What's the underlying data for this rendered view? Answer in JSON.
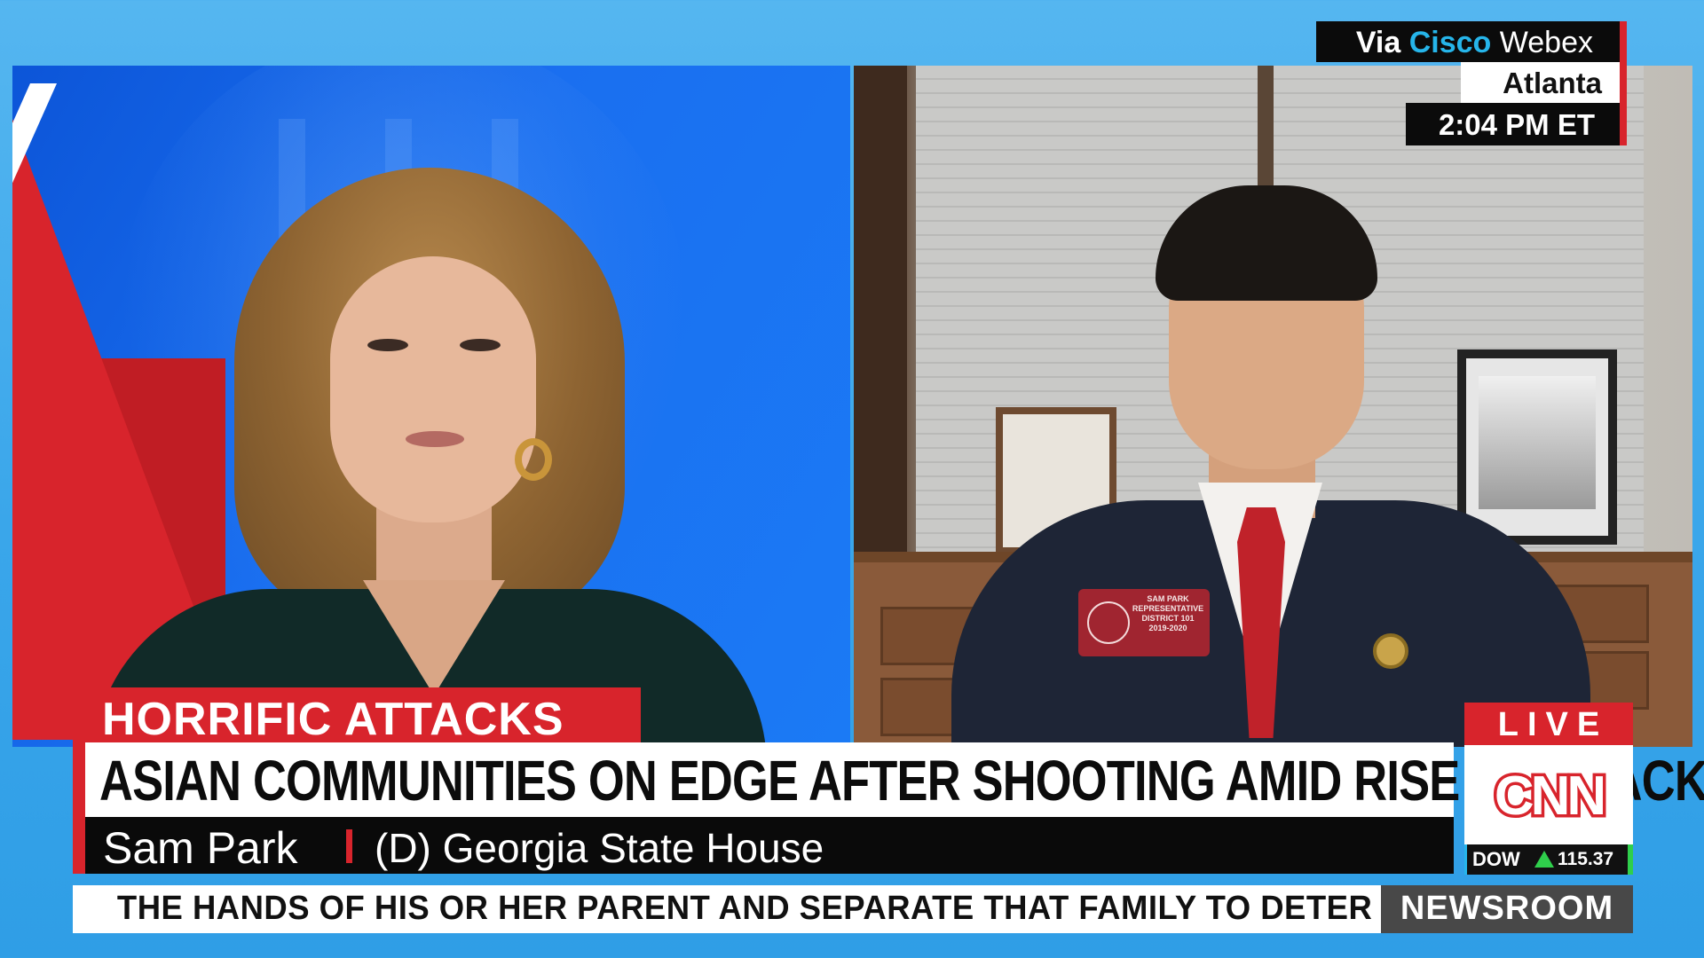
{
  "source_box": {
    "via": "Via",
    "cisco": "Cisco",
    "webex": "Webex"
  },
  "location": "Atlanta",
  "time": "2:04 PM ET",
  "lower_third": {
    "topic": "HORRIFIC ATTACKS",
    "headline": "ASIAN COMMUNITIES ON EDGE AFTER SHOOTING AMID RISE IN ATTACKS",
    "name": "Sam Park",
    "title": "(D) Georgia State House"
  },
  "badge": {
    "name": "SAM PARK",
    "line1": "REPRESENTATIVE",
    "line2": "DISTRICT 101",
    "line3": "2019-2020"
  },
  "live_label": "LIVE",
  "network_logo": "CNN",
  "market": {
    "label": "DOW",
    "direction": "up",
    "value": "115.37"
  },
  "ticker_text": "THE HANDS OF HIS OR HER PARENT AND SEPARATE THAT FAMILY TO DETER",
  "show_name": "NEWSROOM",
  "colors": {
    "cnn_red": "#d8242c",
    "cisco_blue": "#26b5ea",
    "market_up": "#2fcf4c"
  }
}
